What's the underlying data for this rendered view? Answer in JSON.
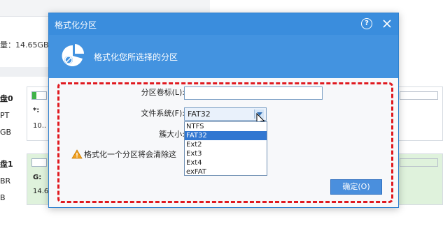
{
  "background": {
    "capacity_text": "量：14.65GB",
    "disk0": {
      "name": "盘0",
      "line2": "PT",
      "line3": "GB"
    },
    "disk1": {
      "name": "盘1",
      "line2": "BR",
      "line3": "B"
    },
    "strip0": {
      "drive": "*:",
      "size": "10.."
    },
    "strip1": {
      "drive": "G:",
      "size": "14.6"
    }
  },
  "dialog": {
    "title": "格式化分区",
    "help_label": "?",
    "header_text": "格式化您所选择的分区",
    "form": {
      "volume_label": "分区卷标(L):",
      "volume_value": "",
      "filesystem_label": "文件系统(F):",
      "filesystem_selected": "FAT32",
      "cluster_label": "簇大小:",
      "filesystem_options": [
        "NTFS",
        "FAT32",
        "Ext2",
        "Ext3",
        "Ext4",
        "exFAT"
      ]
    },
    "warning_text": "格式化一个分区将会清除这",
    "ok_label": "确定(O)"
  },
  "colors": {
    "title_bar": "#3a8ddd",
    "header": "#4393e0",
    "dashed_border": "#e0191f",
    "selected_item": "#3177d1"
  }
}
